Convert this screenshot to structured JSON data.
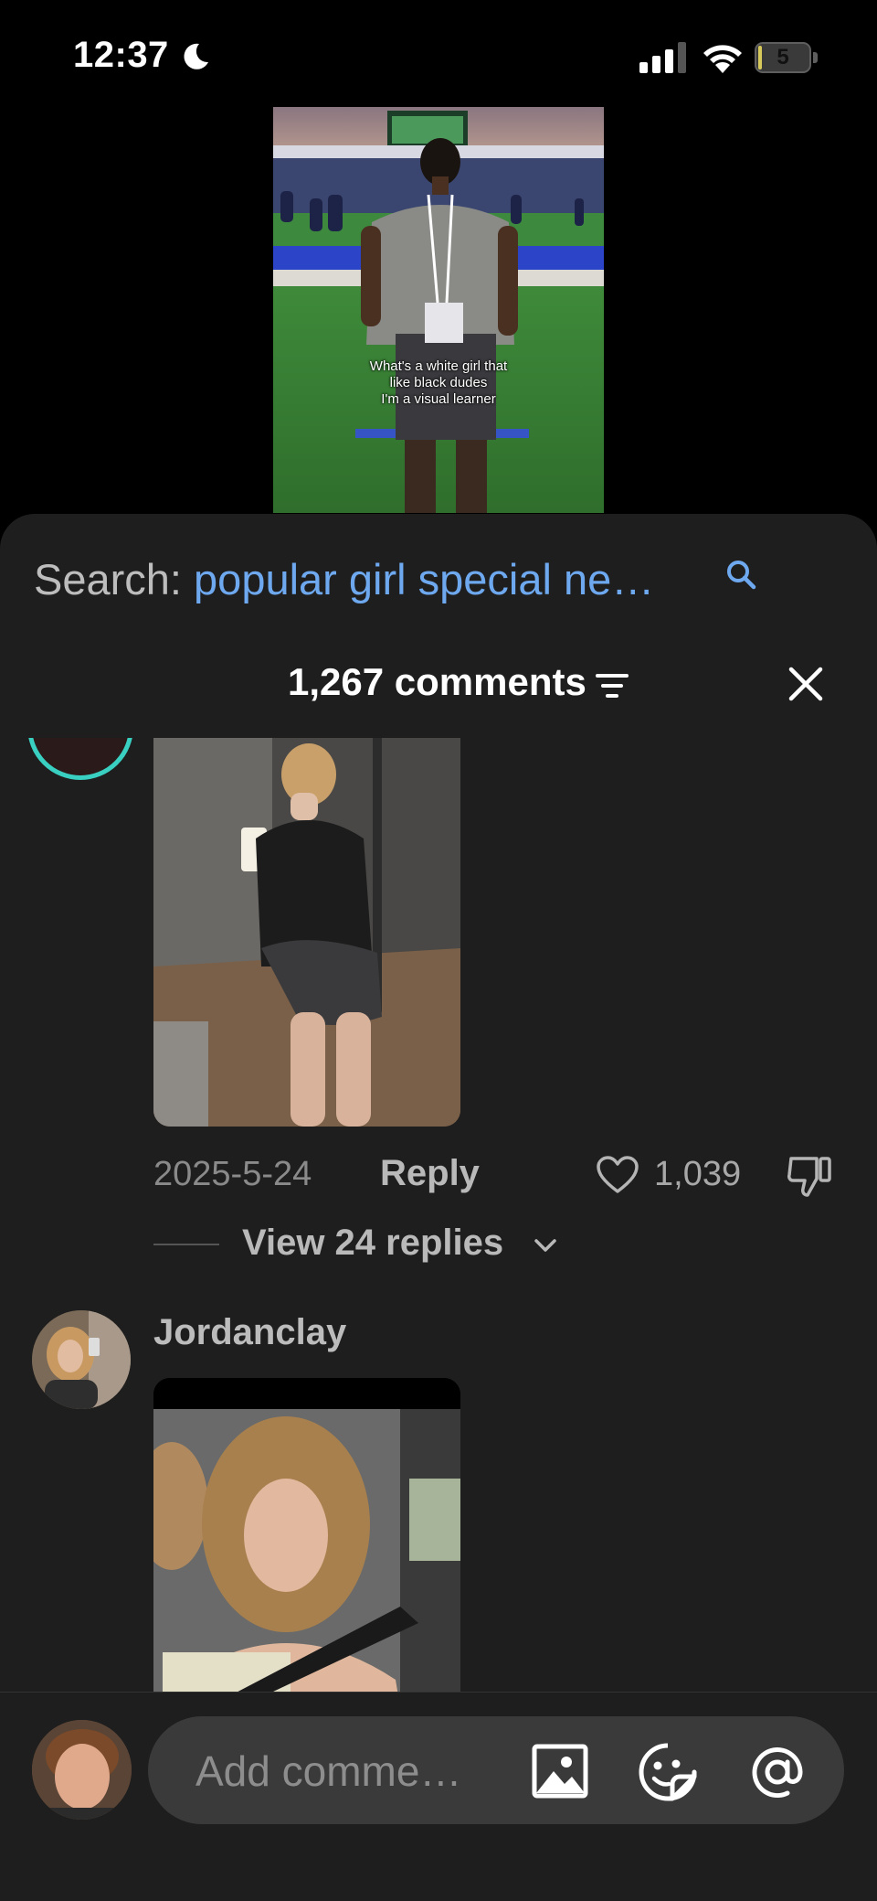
{
  "status_bar": {
    "time": "12:37",
    "battery_level": "5",
    "battery_fraction": 0.05,
    "icons": [
      "moon-icon",
      "cellular-signal-icon",
      "wifi-icon",
      "battery-icon"
    ]
  },
  "video": {
    "caption_lines": [
      "What's a white girl that",
      "like black dudes",
      "I'm a visual learner"
    ]
  },
  "search": {
    "label": "Search:",
    "query": "popular girl special ne…"
  },
  "comments": {
    "count_label": "1,267 comments",
    "items": [
      {
        "date": "2025-5-24",
        "reply_label": "Reply",
        "likes": "1,039",
        "view_replies_label": "View 24 replies"
      },
      {
        "username": "Jordanclay"
      }
    ]
  },
  "composer": {
    "placeholder": "Add comme…"
  },
  "colors": {
    "sheet_bg": "#1e1e1e",
    "search_query": "#6ea8ef",
    "avatar_ring": "#39d0c1"
  }
}
